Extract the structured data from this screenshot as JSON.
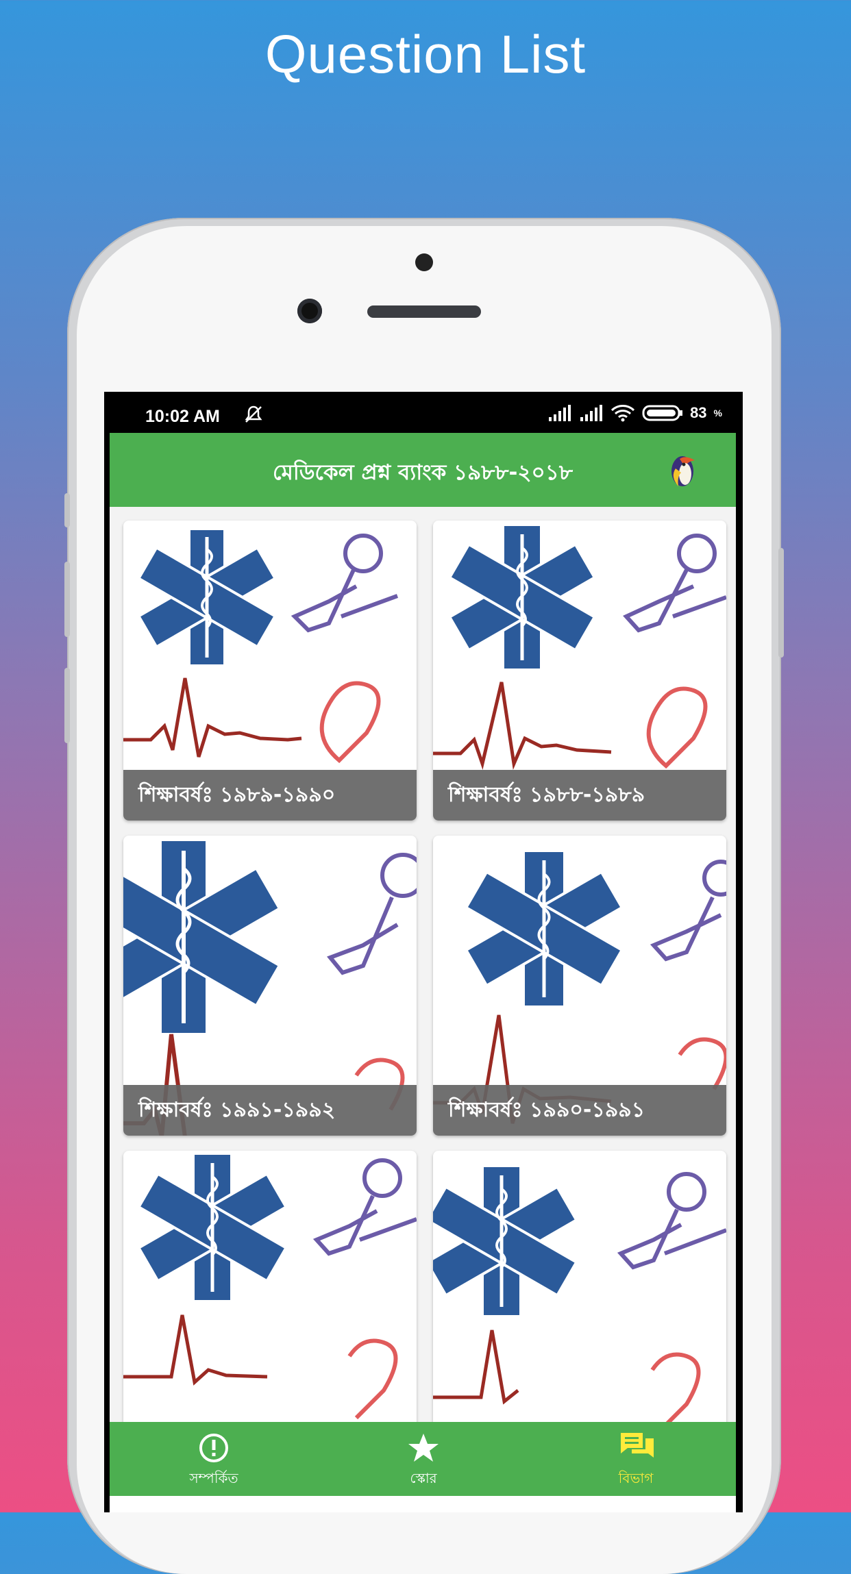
{
  "headline": "Question List",
  "status": {
    "time": "10:02 AM",
    "battery": "83"
  },
  "appbar": {
    "title": "মেডিকেল প্রশ্ন ব্যাংক ১৯৮৮-২০১৮"
  },
  "cards": [
    {
      "label": "শিক্ষাবর্ষঃ ১৯৮৯-১৯৯০"
    },
    {
      "label": "শিক্ষাবর্ষঃ ১৯৮৮-১৯৮৯"
    },
    {
      "label": "শিক্ষাবর্ষঃ ১৯৯১-১৯৯২"
    },
    {
      "label": "শিক্ষাবর্ষঃ ১৯৯০-১৯৯১"
    },
    {
      "label": ""
    },
    {
      "label": ""
    }
  ],
  "bottom_nav": [
    {
      "label": "সম্পর্কিত",
      "icon": "info-icon"
    },
    {
      "label": "স্কোর",
      "icon": "star-icon"
    },
    {
      "label": "বিভাগ",
      "icon": "chat-icon",
      "active": true
    }
  ],
  "colors": {
    "appbar": "#4caf50",
    "active_nav": "#ffeb3b",
    "star_of_life": "#2b5a9a"
  }
}
